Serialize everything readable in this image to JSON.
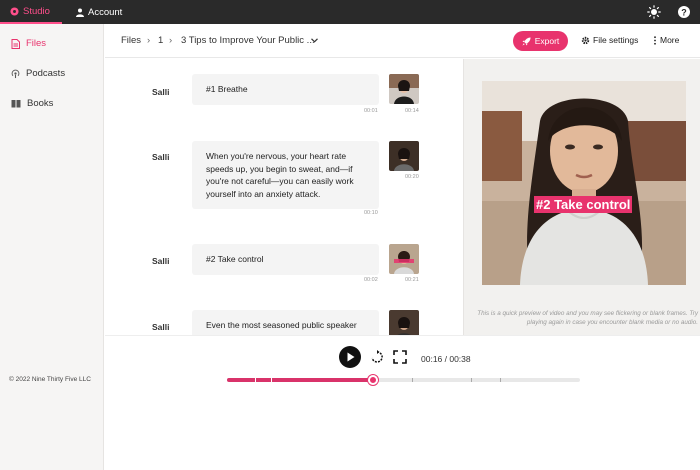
{
  "topbar": {
    "tabs": [
      {
        "label": "Studio",
        "icon": "studio-icon",
        "active": true
      },
      {
        "label": "Account",
        "icon": "user-icon",
        "active": false
      }
    ],
    "right_icons": [
      "brightness-icon",
      "help-icon"
    ]
  },
  "sidebar": {
    "items": [
      {
        "label": "Files",
        "icon": "file-icon",
        "active": true
      },
      {
        "label": "Podcasts",
        "icon": "podcast-icon",
        "active": false
      },
      {
        "label": "Books",
        "icon": "book-icon",
        "active": false
      }
    ],
    "footer": "© 2022 Nine Thirty Five LLC"
  },
  "header": {
    "breadcrumb": [
      "Files",
      "1",
      "3 Tips to Improve Your Public ..."
    ],
    "separator": "›",
    "export_label": "Export",
    "file_settings_label": "File settings",
    "more_label": "More"
  },
  "script": {
    "rows": [
      {
        "speaker": "Salli",
        "text": "#1 Breathe",
        "start": "00:01",
        "end": "00:14"
      },
      {
        "speaker": "Salli",
        "text": "When you're nervous, your heart rate speeds up, you begin to sweat, and—if you're not careful—you can easily work yourself into an anxiety attack.",
        "start": "00:10",
        "end": "00:20"
      },
      {
        "speaker": "Salli",
        "text": "#2 Take control",
        "start": "00:02",
        "end": "00:21"
      },
      {
        "speaker": "Salli",
        "text": "Even the most seasoned public speaker",
        "start": "",
        "end": ""
      }
    ]
  },
  "preview": {
    "caption": "#2 Take control",
    "note": "This is a quick preview of video and you may see flickering or blank frames. Try playing again in case you encounter blank media or no audio."
  },
  "player": {
    "time": "00:16 / 00:38",
    "progress": 0.415,
    "colors": {
      "accent": "#e8336d",
      "dark": "#2a2a2a"
    }
  }
}
